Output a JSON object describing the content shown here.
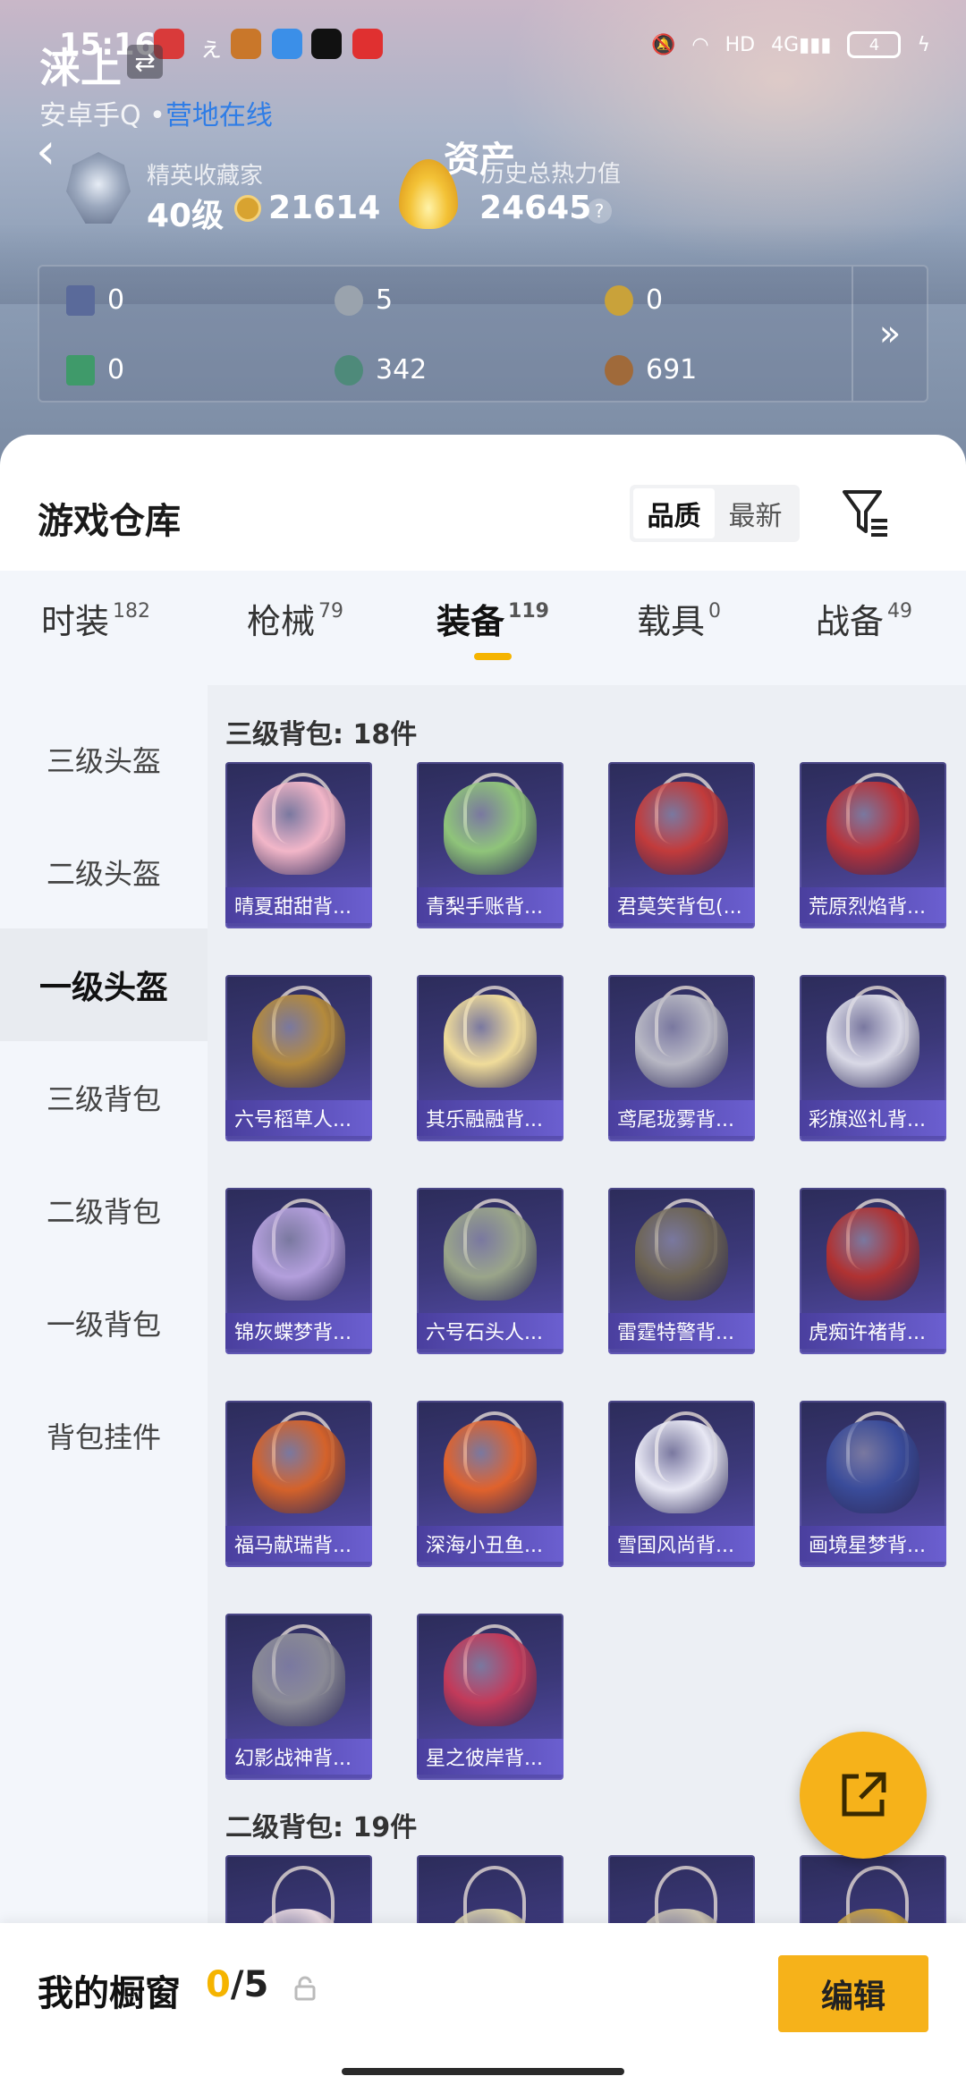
{
  "status_bar": {
    "time": "15:16",
    "battery": "4",
    "network": "4G"
  },
  "profile": {
    "name": "涞上",
    "subtitle_prefix": "安卓手Q •",
    "subtitle_status": "营地在线",
    "collector_label": "精英收藏家",
    "level": "40级",
    "coins": "21614",
    "assets_title": "资产",
    "heat_label": "历史总热力值",
    "heat_value": "24645",
    "help": "?"
  },
  "stats": [
    {
      "icon": "card-icon",
      "value": "0",
      "color": "#5a6a9a"
    },
    {
      "icon": "silver-coin-icon",
      "value": "5",
      "color": "#9aa3ad"
    },
    {
      "icon": "gold-medal-icon",
      "value": "0",
      "color": "#c9a23a"
    },
    {
      "icon": "green-card-icon",
      "value": "0",
      "color": "#3f9a6a"
    },
    {
      "icon": "gem-icon",
      "value": "342",
      "color": "#4e8a7a"
    },
    {
      "icon": "bronze-coin-icon",
      "value": "691",
      "color": "#a06a3a"
    }
  ],
  "warehouse": {
    "title": "游戏仓库",
    "sort_options": [
      "品质",
      "最新"
    ],
    "tabs": [
      {
        "label": "时装",
        "count": "182"
      },
      {
        "label": "枪械",
        "count": "79"
      },
      {
        "label": "装备",
        "count": "119"
      },
      {
        "label": "载具",
        "count": "0"
      },
      {
        "label": "战备",
        "count": "49"
      }
    ],
    "sidebar": [
      "三级头盔",
      "二级头盔",
      "一级头盔",
      "三级背包",
      "二级背包",
      "一级背包",
      "背包挂件"
    ],
    "section1_title": "三级背包: 18件",
    "section2_title": "二级背包: 19件",
    "items": [
      {
        "label": "晴夏甜甜背...",
        "color": "#f2b6c8"
      },
      {
        "label": "青梨手账背...",
        "color": "#8fc47a"
      },
      {
        "label": "君莫笑背包(...",
        "color": "#c23b3b"
      },
      {
        "label": "荒原烈焰背...",
        "color": "#b8333a"
      },
      {
        "label": "六号稻草人...",
        "color": "#b48a3c"
      },
      {
        "label": "其乐融融背...",
        "color": "#f0dc9a"
      },
      {
        "label": "鸢尾珑雾背...",
        "color": "#b8b8c4"
      },
      {
        "label": "彩旗巡礼背...",
        "color": "#d9d9e6"
      },
      {
        "label": "锦灰蝶梦背...",
        "color": "#b39fdc"
      },
      {
        "label": "六号石头人...",
        "color": "#9aa58a"
      },
      {
        "label": "雷霆特警背...",
        "color": "#6d6454"
      },
      {
        "label": "虎痴许褚背...",
        "color": "#b03232"
      },
      {
        "label": "福马献瑞背...",
        "color": "#d4622a"
      },
      {
        "label": "深海小丑鱼...",
        "color": "#e0622c"
      },
      {
        "label": "雪国风尚背...",
        "color": "#e8e8f4"
      },
      {
        "label": "画境星梦背...",
        "color": "#3a4c9a"
      },
      {
        "label": "幻影战神背...",
        "color": "#8a8a96"
      },
      {
        "label": "星之彼岸背...",
        "color": "#c23a5a"
      }
    ],
    "preview_items": [
      {
        "color": "#e8d8e0"
      },
      {
        "color": "#d8cfa8"
      },
      {
        "color": "#c8c0b0"
      },
      {
        "color": "#c8a040"
      }
    ]
  },
  "showcase": {
    "title": "我的橱窗",
    "used": "0",
    "total": "/5",
    "edit_label": "编辑"
  },
  "accent": "#f6b21a"
}
